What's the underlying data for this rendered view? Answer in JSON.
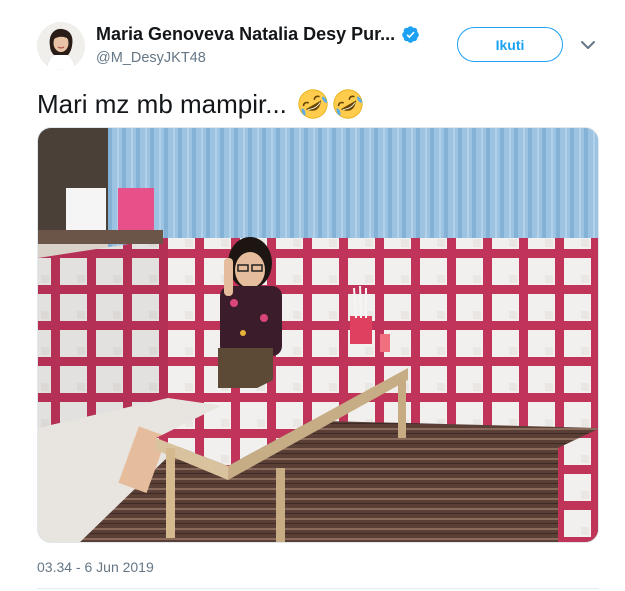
{
  "author": {
    "display_name": "Maria Genoveva Natalia Desy Pur...",
    "handle": "@M_DesyJKT48",
    "verified": true,
    "avatar_icon": "profile-avatar"
  },
  "actions": {
    "follow_label": "Ikuti",
    "more_icon": "chevron-down-icon"
  },
  "tweet": {
    "text": "Mari mz mb mampir...",
    "emojis": [
      "rolling-on-floor-laughing",
      "rolling-on-floor-laughing"
    ],
    "media_description_icon": "photo",
    "timestamp": "03.34 - 6 Jun 2019"
  },
  "colors": {
    "accent": "#1da1f2",
    "text_primary": "#14171a",
    "text_secondary": "#657786",
    "divider": "#e6ecf0"
  }
}
